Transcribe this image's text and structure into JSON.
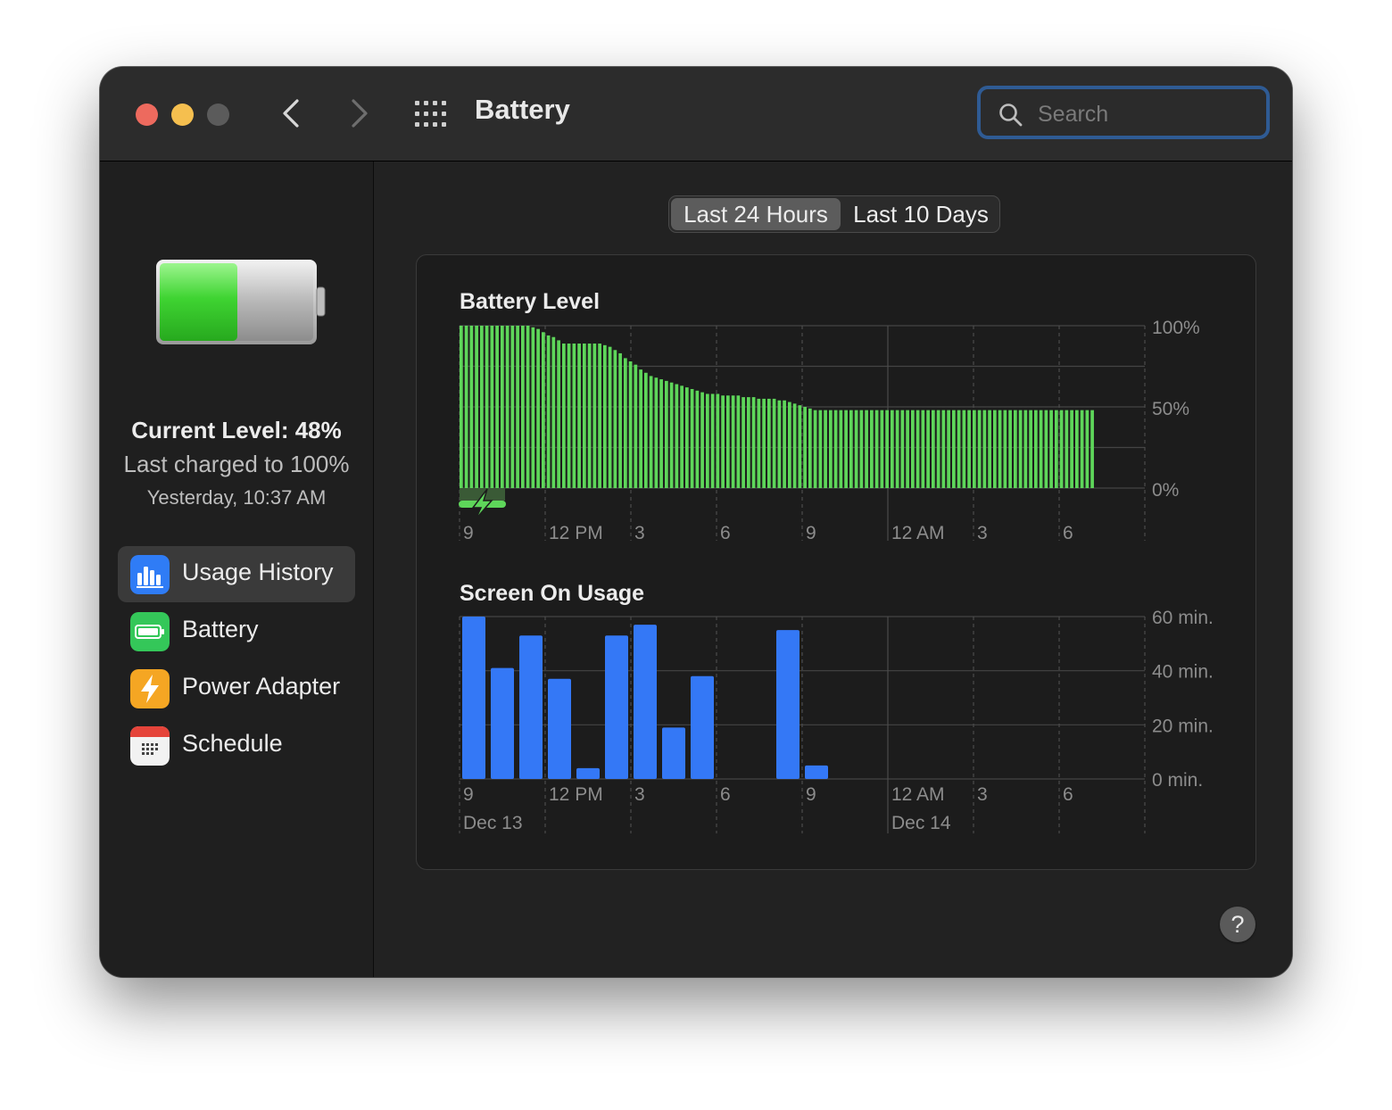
{
  "window": {
    "title": "Battery",
    "search_placeholder": "Search"
  },
  "sidebar": {
    "current_level": "Current Level: 48%",
    "last_charged": "Last charged to 100%",
    "last_charged_time": "Yesterday, 10:37 AM",
    "battery_fill_fraction": 0.48,
    "items": [
      {
        "label": "Usage History",
        "icon": "bar-chart-icon",
        "active": true
      },
      {
        "label": "Battery",
        "icon": "battery-icon",
        "active": false
      },
      {
        "label": "Power Adapter",
        "icon": "lightning-icon",
        "active": false
      },
      {
        "label": "Schedule",
        "icon": "calendar-icon",
        "active": false
      }
    ]
  },
  "range_tabs": {
    "options": [
      "Last 24 Hours",
      "Last 10 Days"
    ],
    "selected": "Last 24 Hours"
  },
  "help_label": "?",
  "chart_data": [
    {
      "type": "bar",
      "title": "Battery Level",
      "ylabels": [
        "100%",
        "50%",
        "0%"
      ],
      "ylim": [
        0,
        100
      ],
      "xlabels": [
        "9",
        "12 PM",
        "3",
        "6",
        "9",
        "12 AM",
        "3",
        "6"
      ],
      "x": "sequential samples, Dec 13 9 AM to Dec 14 ~7 AM",
      "values": [
        100,
        100,
        100,
        100,
        100,
        100,
        100,
        100,
        100,
        100,
        100,
        100,
        100,
        100,
        99,
        98,
        96,
        94,
        93,
        91,
        89,
        89,
        89,
        89,
        89,
        89,
        89,
        89,
        88,
        87,
        85,
        83,
        80,
        78,
        76,
        73,
        71,
        69,
        68,
        67,
        66,
        65,
        64,
        63,
        62,
        61,
        60,
        59,
        58,
        58,
        58,
        57,
        57,
        57,
        57,
        56,
        56,
        56,
        55,
        55,
        55,
        55,
        54,
        54,
        53,
        52,
        51,
        50,
        49,
        48,
        48,
        48,
        48,
        48,
        48,
        48,
        48,
        48,
        48,
        48,
        48,
        48,
        48,
        48,
        48,
        48,
        48,
        48,
        48,
        48,
        48,
        48,
        48,
        48,
        48,
        48,
        48,
        48,
        48,
        48,
        48,
        48,
        48,
        48,
        48,
        48,
        48,
        48,
        48,
        48,
        48,
        48,
        48,
        48,
        48,
        48,
        48,
        48,
        48,
        48,
        48,
        48,
        48,
        48
      ],
      "charging_marker": "lightning at start",
      "series_color": "#5ed65a"
    },
    {
      "type": "bar",
      "title": "Screen On Usage",
      "ylabels": [
        "60 min.",
        "40 min.",
        "20 min.",
        "0 min."
      ],
      "ylim": [
        0,
        60
      ],
      "xlabels": [
        "9",
        "12 PM",
        "3",
        "6",
        "9",
        "12 AM",
        "3",
        "6"
      ],
      "date_labels": [
        "Dec 13",
        "Dec 14"
      ],
      "hours": [
        "9 AM",
        "10 AM",
        "11 AM",
        "12 PM",
        "1 PM",
        "2 PM",
        "3 PM",
        "4 PM",
        "5 PM",
        "6 PM",
        "7 PM",
        "8 PM",
        "9 PM",
        "10 PM"
      ],
      "values": [
        60,
        41,
        53,
        37,
        4,
        53,
        57,
        19,
        38,
        0,
        0,
        55,
        5,
        0
      ],
      "series_color": "#3478f6"
    }
  ]
}
